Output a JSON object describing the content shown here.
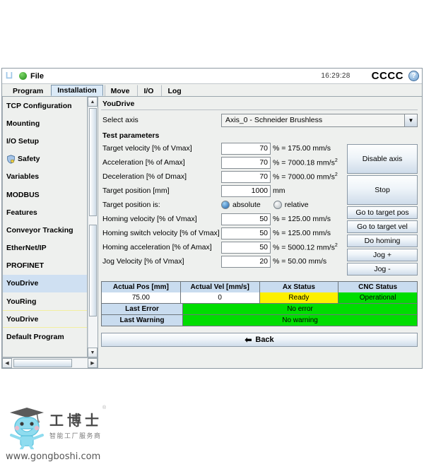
{
  "titlebar": {
    "logo_name": "ur-logo-icon",
    "file_label": "File",
    "clock": "16:29:28",
    "brand": "CCCC",
    "help_label": "?"
  },
  "tabs": [
    {
      "label": "Program",
      "active": false
    },
    {
      "label": "Installation",
      "active": true
    },
    {
      "label": "Move",
      "active": false
    },
    {
      "label": "I/O",
      "active": false
    },
    {
      "label": "Log",
      "active": false
    }
  ],
  "sidebar": {
    "items": [
      {
        "label": "TCP Configuration",
        "icon": null,
        "selected": false
      },
      {
        "label": "Mounting",
        "icon": null,
        "selected": false
      },
      {
        "label": "I/O Setup",
        "icon": null,
        "selected": false
      },
      {
        "label": "Safety",
        "icon": "shield-lock-icon",
        "selected": false
      },
      {
        "label": "Variables",
        "icon": null,
        "selected": false
      },
      {
        "label": "MODBUS",
        "icon": null,
        "selected": false
      },
      {
        "label": "Features",
        "icon": null,
        "selected": false
      },
      {
        "label": "Conveyor Tracking",
        "icon": null,
        "selected": false
      },
      {
        "label": "EtherNet/IP",
        "icon": null,
        "selected": false
      },
      {
        "label": "PROFINET",
        "icon": null,
        "selected": false
      },
      {
        "label": "YouDrive",
        "icon": null,
        "selected": true
      },
      {
        "label": "YouRing",
        "icon": null,
        "selected": false
      },
      {
        "label": "YouDrive",
        "icon": null,
        "selected": false,
        "divider": true
      },
      {
        "label": "Default Program",
        "icon": null,
        "selected": false
      }
    ]
  },
  "main": {
    "panel_title": "YouDrive",
    "select_axis_label": "Select axis",
    "select_axis_value": "Axis_0 - Schneider Brushless",
    "section_header": "Test parameters",
    "fields": [
      {
        "label": "Target velocity [% of Vmax]",
        "value": "70",
        "unit_pre": "% = 175.00 mm/s",
        "sup": ""
      },
      {
        "label": "Acceleration [% of Amax]",
        "value": "70",
        "unit_pre": "% = 7000.18 mm/s",
        "sup": "2"
      },
      {
        "label": "Deceleration [% of Dmax]",
        "value": "70",
        "unit_pre": "% = 7000.00 mm/s",
        "sup": "2"
      },
      {
        "label": "Target position [mm]",
        "value": "1000",
        "unit_pre": "mm",
        "sup": ""
      }
    ],
    "target_position_is_label": "Target position is:",
    "radios": [
      {
        "label": "absolute",
        "selected": true
      },
      {
        "label": "relative",
        "selected": false
      }
    ],
    "fields2": [
      {
        "label": "Homing velocity [% of Vmax]",
        "value": "50",
        "unit_pre": "% = 125.00 mm/s",
        "sup": ""
      },
      {
        "label": "Homing switch velocity [% of Vmax]",
        "value": "50",
        "unit_pre": "% = 125.00 mm/s",
        "sup": ""
      },
      {
        "label": "Homing acceleration [% of Amax]",
        "value": "50",
        "unit_pre": "% = 5000.12 mm/s",
        "sup": "2"
      },
      {
        "label": "Jog Velocity [% of Vmax]",
        "value": "20",
        "unit_pre": "% = 50.00 mm/s",
        "sup": ""
      }
    ],
    "buttons": [
      {
        "label": "Disable axis",
        "tall": true
      },
      {
        "label": "Stop",
        "tall": true
      },
      {
        "label": "Go to target pos",
        "tall": false
      },
      {
        "label": "Go to target vel",
        "tall": false
      },
      {
        "label": "Do homing",
        "tall": false
      },
      {
        "label": "Jog +",
        "tall": false
      },
      {
        "label": "Jog -",
        "tall": false
      }
    ],
    "status_table": {
      "headers": [
        "Actual Pos [mm]",
        "Actual Vel [mm/s]",
        "Ax Status",
        "CNC Status"
      ],
      "values": [
        "75.00",
        "0",
        "Ready",
        "Operational"
      ],
      "ax_status_color": "#fdf000",
      "cnc_status_color": "#00dd00",
      "rows": [
        {
          "label": "Last Error",
          "value": "No error",
          "color": "#00dd00"
        },
        {
          "label": "Last Warning",
          "value": "No warning",
          "color": "#00dd00"
        }
      ]
    },
    "back_button": "Back",
    "back_icon": "arrow-left-icon"
  },
  "watermark": {
    "cn_title": "工博士",
    "cn_sub": "智能工厂服务商",
    "url": "www.gongboshi.com",
    "registered_mark": "®",
    "mascot_icon": "robot-mascot-icon",
    "accent_color": "#7fd4e8"
  }
}
